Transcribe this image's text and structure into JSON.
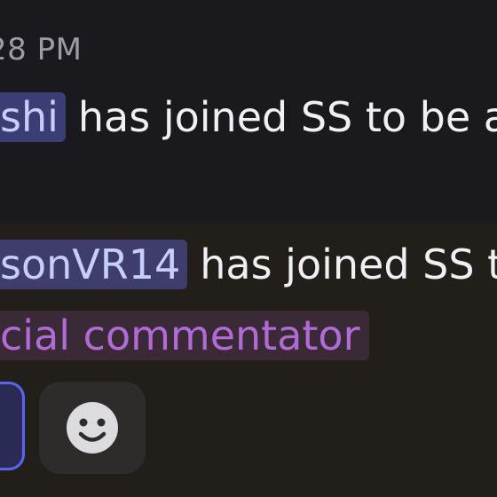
{
  "message1": {
    "timestamp": "28 PM",
    "mention": "shi",
    "text": "has joined SS to be a"
  },
  "message2": {
    "mention": "sonVR14",
    "text": "has joined SS t",
    "role": "cial commentator"
  },
  "colors": {
    "background_top": "#1a1a1e",
    "background_bottom": "#221f1b",
    "mention_bg": "#3b3d75",
    "mention_text": "#c9cdfb",
    "role_text": "#b26ad8",
    "accent": "#5865f2"
  },
  "icons": {
    "add_reaction": "smile-face-icon"
  }
}
